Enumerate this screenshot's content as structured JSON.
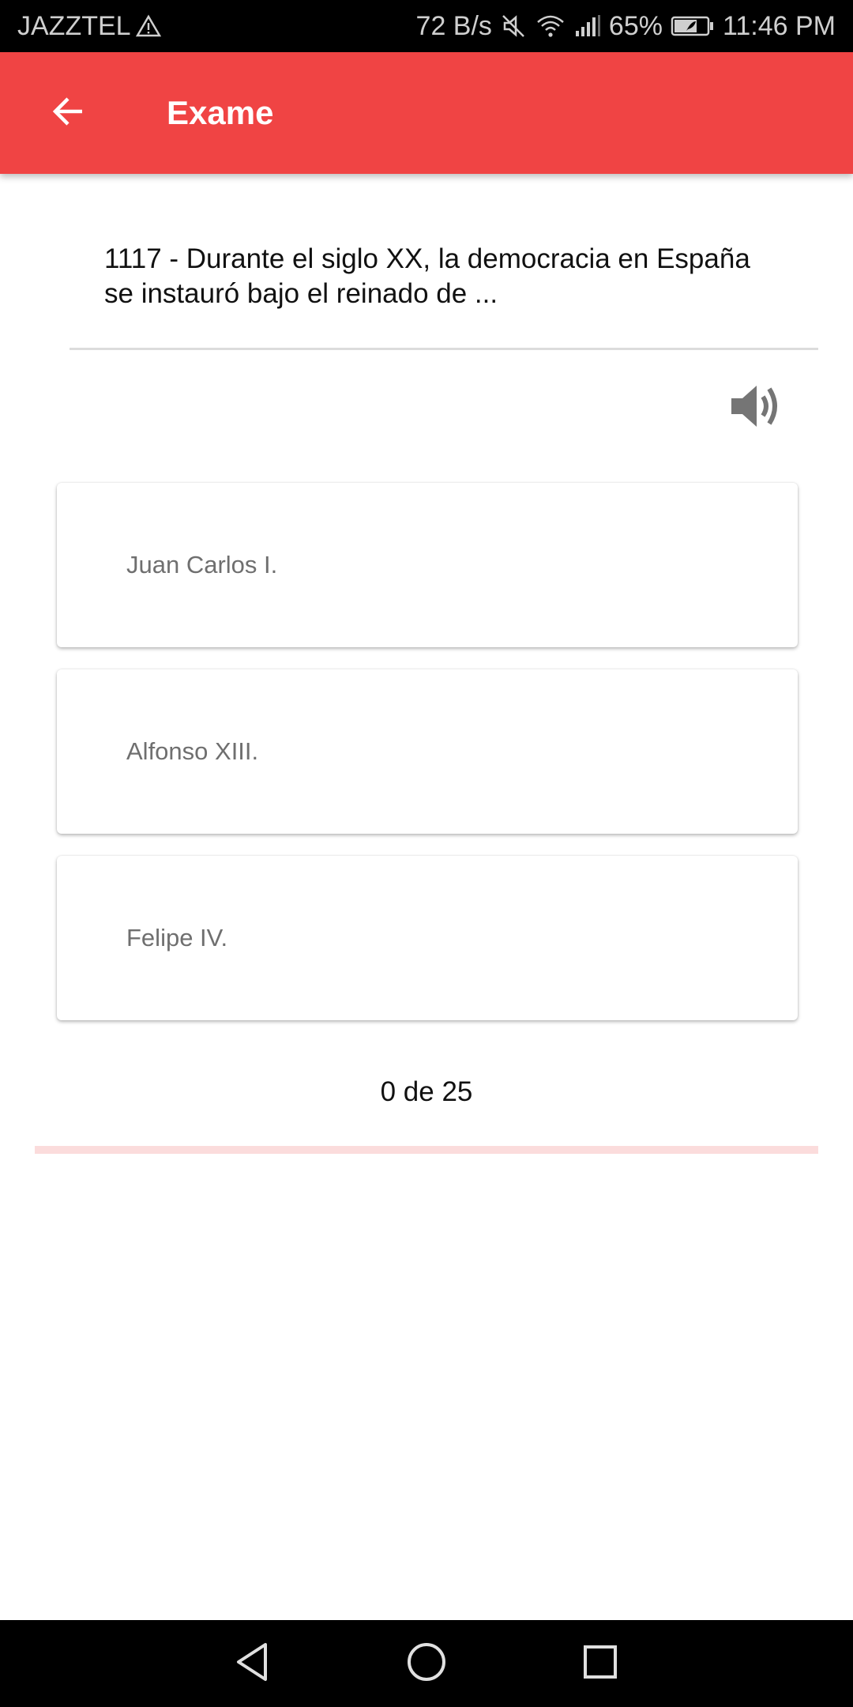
{
  "status_bar": {
    "carrier": "JAZZTEL",
    "net_speed": "72 B/s",
    "battery": "65%",
    "time": "11:46 PM"
  },
  "app_bar": {
    "title": "Exame",
    "background": "#f04444"
  },
  "question": {
    "text": "1117 - Durante el siglo XX, la democracia en España se instauró bajo el reinado de ..."
  },
  "answers": [
    {
      "label": "Juan Carlos I."
    },
    {
      "label": "Alfonso XIII."
    },
    {
      "label": "Felipe IV."
    }
  ],
  "progress": {
    "text": "0 de 25",
    "current": 0,
    "total": 25
  },
  "icons": {
    "back": "arrow-left-icon",
    "audio": "speaker-icon",
    "nav": [
      "back-triangle-icon",
      "home-circle-icon",
      "recents-square-icon"
    ]
  }
}
